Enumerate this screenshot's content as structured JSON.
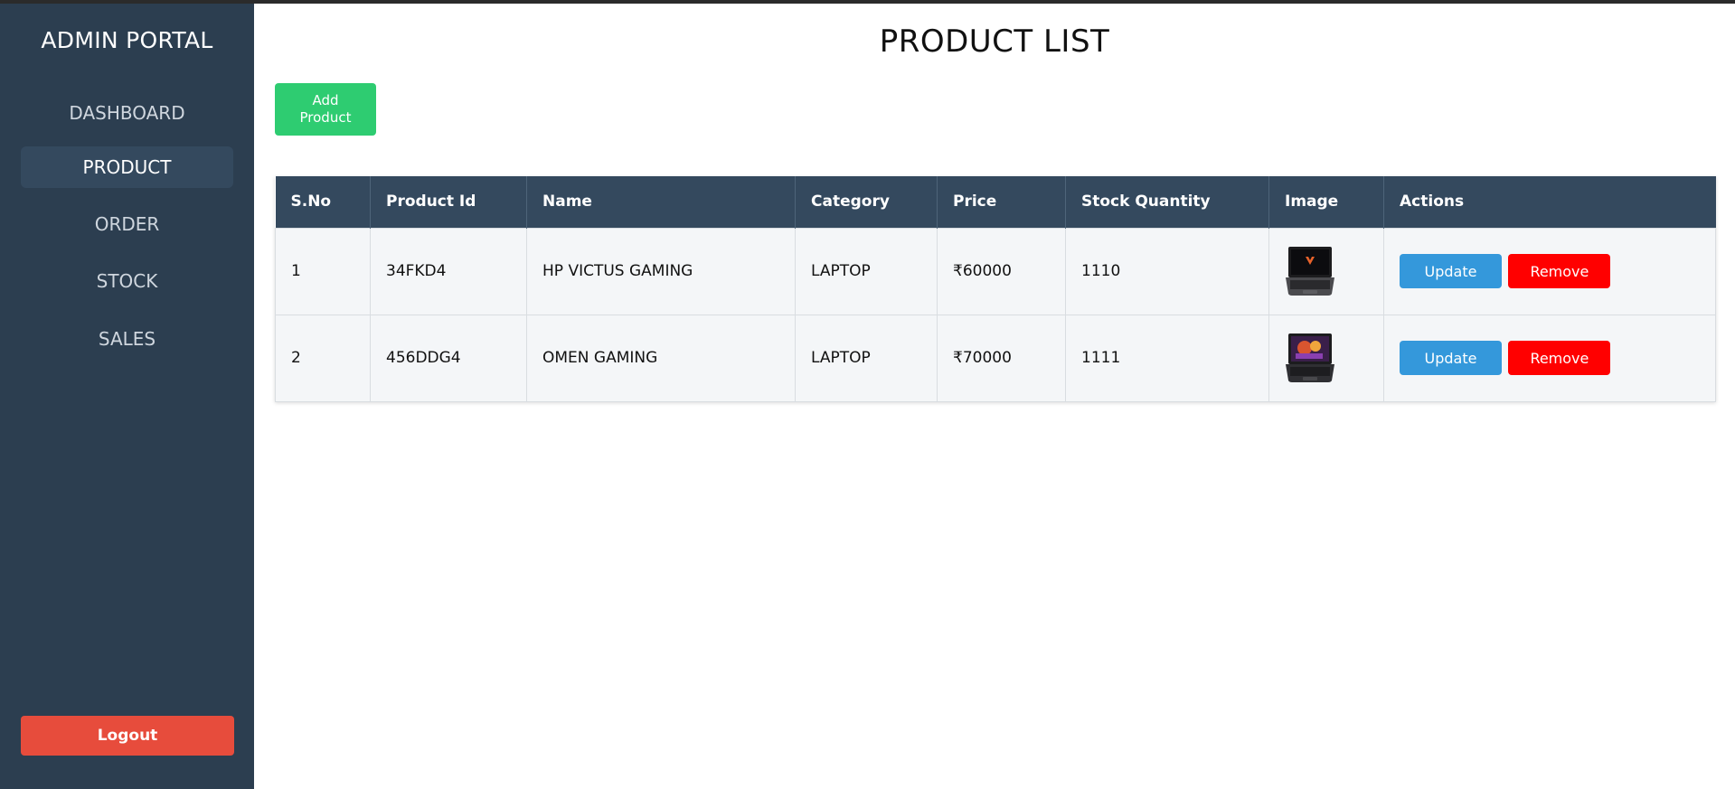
{
  "sidebar": {
    "brand": "ADMIN PORTAL",
    "items": [
      {
        "label": "DASHBOARD",
        "active": false
      },
      {
        "label": "PRODUCT",
        "active": true
      },
      {
        "label": "ORDER",
        "active": false
      },
      {
        "label": "STOCK",
        "active": false
      },
      {
        "label": "SALES",
        "active": false
      }
    ],
    "logout_label": "Logout"
  },
  "main": {
    "title": "PRODUCT LIST",
    "add_button_label": "Add Product",
    "table": {
      "headers": [
        "S.No",
        "Product Id",
        "Name",
        "Category",
        "Price",
        "Stock Quantity",
        "Image",
        "Actions"
      ],
      "rows": [
        {
          "sno": "1",
          "product_id": "34FKD4",
          "name": "HP VICTUS GAMING",
          "category": "LAPTOP",
          "price": "₹60000",
          "stock": "1110",
          "image_icon": "laptop-thumbnail-icon",
          "update_label": "Update",
          "remove_label": "Remove"
        },
        {
          "sno": "2",
          "product_id": "456DDG4",
          "name": "OMEN GAMING",
          "category": "LAPTOP",
          "price": "₹70000",
          "stock": "1111",
          "image_icon": "laptop-thumbnail-icon",
          "update_label": "Update",
          "remove_label": "Remove"
        }
      ]
    }
  },
  "colors": {
    "sidebar_bg": "#2c3e50",
    "header_bg": "#34495e",
    "add_button": "#2ecc71",
    "update_button": "#3498db",
    "remove_button": "#ff0000",
    "logout_button": "#e74c3c"
  }
}
